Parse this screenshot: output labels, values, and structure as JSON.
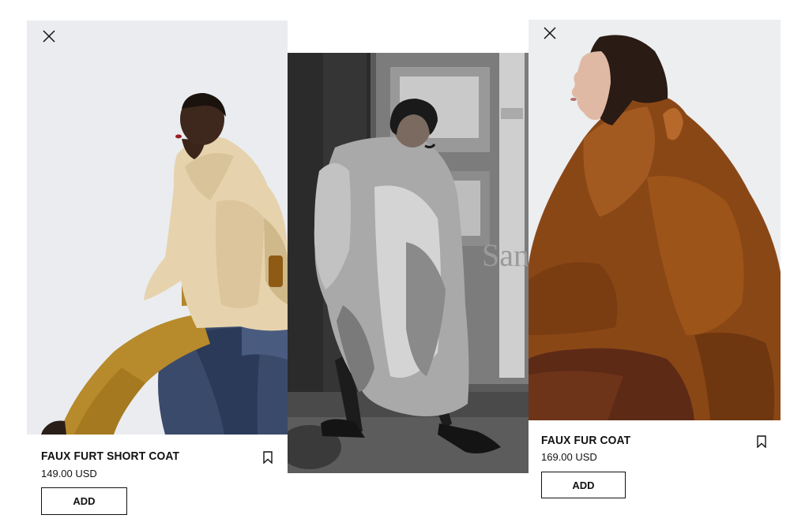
{
  "products": [
    {
      "title": "FAUX FURT SHORT COAT",
      "price": "149.00 USD",
      "add_label": "ADD",
      "close_icon": "close-icon",
      "bookmark_icon": "bookmark-icon"
    },
    {
      "title": "FAUX FUR COAT",
      "price": "169.00 USD",
      "add_label": "ADD",
      "close_icon": "close-icon",
      "bookmark_icon": "bookmark-icon"
    }
  ],
  "editorial": {
    "sign_text": "San"
  },
  "colors": {
    "text": "#111111",
    "background": "#ffffff",
    "photo_backdrop": "#eceef1"
  }
}
